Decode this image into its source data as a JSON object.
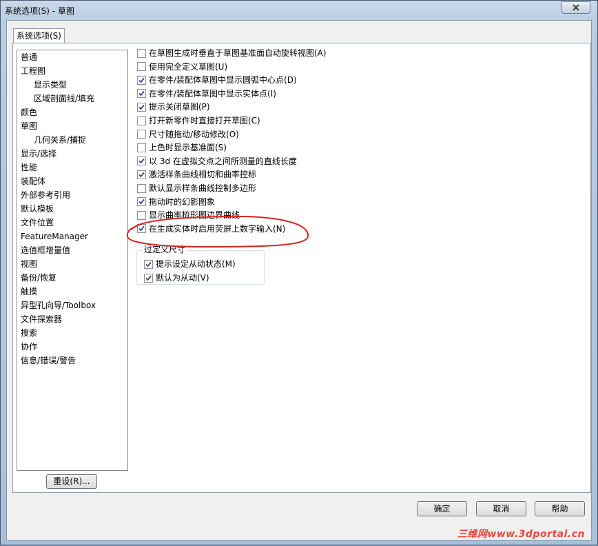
{
  "window": {
    "title": "系统选项(S) - 草图"
  },
  "tabs": [
    {
      "label": "系统选项(S)"
    }
  ],
  "tree": {
    "items": [
      {
        "label": "普通",
        "child": false
      },
      {
        "label": "工程图",
        "child": false
      },
      {
        "label": "显示类型",
        "child": true
      },
      {
        "label": "区域剖面线/填充",
        "child": true
      },
      {
        "label": "颜色",
        "child": false
      },
      {
        "label": "草图",
        "child": false
      },
      {
        "label": "几何关系/捕捉",
        "child": true
      },
      {
        "label": "显示/选择",
        "child": false
      },
      {
        "label": "性能",
        "child": false
      },
      {
        "label": "装配体",
        "child": false
      },
      {
        "label": "外部参考引用",
        "child": false
      },
      {
        "label": "默认模板",
        "child": false
      },
      {
        "label": "文件位置",
        "child": false
      },
      {
        "label": "FeatureManager",
        "child": false
      },
      {
        "label": "选值框增量值",
        "child": false
      },
      {
        "label": "视图",
        "child": false
      },
      {
        "label": "备份/恢复",
        "child": false
      },
      {
        "label": "触摸",
        "child": false
      },
      {
        "label": "异型孔向导/Toolbox",
        "child": false
      },
      {
        "label": "文件探索器",
        "child": false
      },
      {
        "label": "搜索",
        "child": false
      },
      {
        "label": "协作",
        "child": false
      },
      {
        "label": "信息/错误/警告",
        "child": false
      }
    ],
    "reset_label": "重设(R)..."
  },
  "options": [
    {
      "label": "在草图生成时垂直于草图基准面自动旋转视图(A)",
      "checked": false
    },
    {
      "label": "使用完全定义草图(U)",
      "checked": false
    },
    {
      "label": "在零件/装配体草图中显示圆弧中心点(D)",
      "checked": true
    },
    {
      "label": "在零件/装配体草图中显示实体点(I)",
      "checked": true
    },
    {
      "label": "提示关闭草图(P)",
      "checked": true
    },
    {
      "label": "打开新零件时直接打开草图(C)",
      "checked": false
    },
    {
      "label": "尺寸随拖动/移动修改(O)",
      "checked": false
    },
    {
      "label": "上色时显示基准面(S)",
      "checked": false
    },
    {
      "label": "以 3d 在虚拟交点之间所测量的直线长度",
      "checked": true
    },
    {
      "label": "激活样条曲线相切和曲率控标",
      "checked": true
    },
    {
      "label": "默认显示样条曲线控制多边形",
      "checked": false
    },
    {
      "label": "拖动时的幻影图象",
      "checked": true
    },
    {
      "label": "显示曲率梳形图边界曲线",
      "checked": false
    },
    {
      "label": "在生成实体时启用荧屏上数字输入(N)",
      "checked": true
    }
  ],
  "overdefine_group": {
    "legend": "过定义尺寸",
    "options": [
      {
        "label": "提示设定从动状态(M)",
        "checked": true
      },
      {
        "label": "默认为从动(V)",
        "checked": true
      }
    ]
  },
  "footer": {
    "ok_label": "确定",
    "cancel_label": "取消",
    "help_label": "帮助"
  },
  "watermark": "三维网www.3dportal.cn",
  "colors": {
    "annotation_red": "#d9231c",
    "checkmark": "#2a4a8a"
  }
}
